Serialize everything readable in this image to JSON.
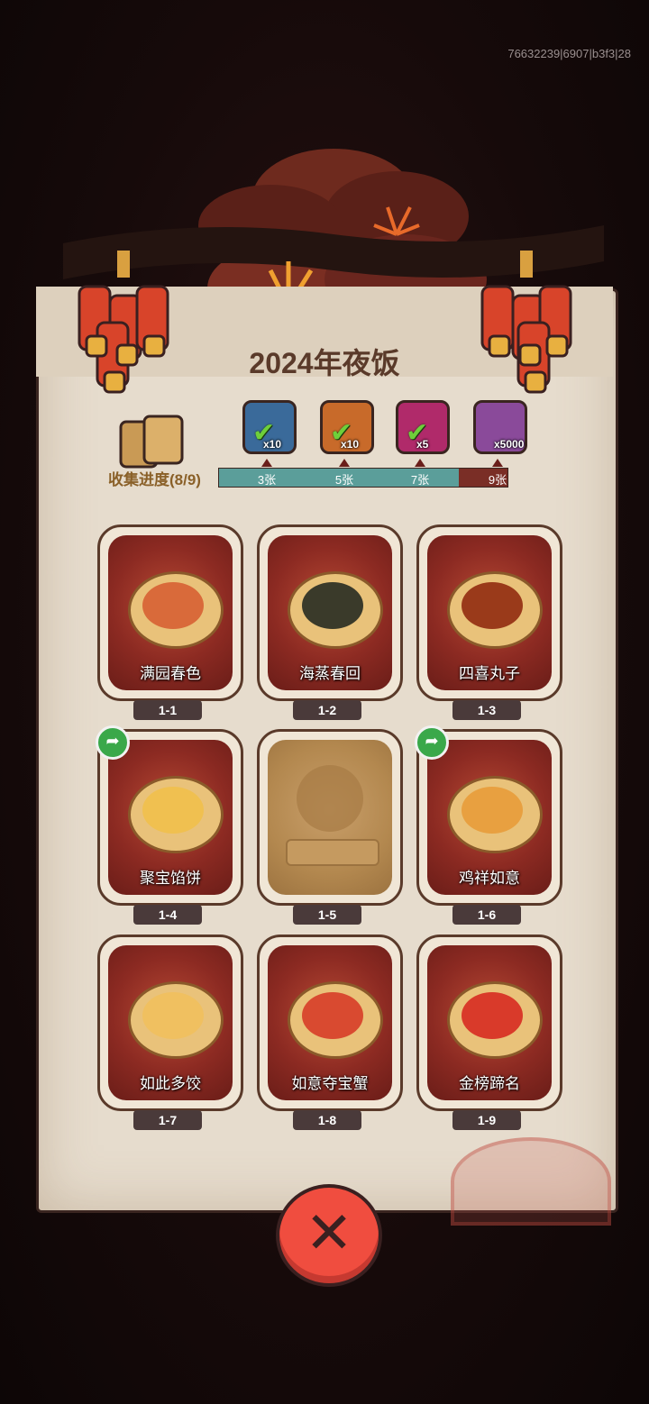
{
  "debug_id": "76632239|6907|b3f3|28",
  "title": "2024年夜饭",
  "collection": {
    "label": "收集进度(8/9)",
    "collected": 8,
    "total": 9,
    "fill_fraction": 0.83,
    "milestones": [
      {
        "label": "3张",
        "claimed": true,
        "reward_icon": "blue-tool-icon",
        "count": "x10"
      },
      {
        "label": "5张",
        "claimed": true,
        "reward_icon": "orange-key-icon",
        "count": "x10"
      },
      {
        "label": "7张",
        "claimed": true,
        "reward_icon": "purple-orb-icon",
        "count": "x5"
      },
      {
        "label": "9张",
        "claimed": false,
        "reward_icon": "crystal-icon",
        "count": "x5000"
      }
    ]
  },
  "cards": [
    {
      "name": "满园春色",
      "number": "1-1",
      "locked": false,
      "shareable": false,
      "food_color": "#d96a3a"
    },
    {
      "name": "海蒸春回",
      "number": "1-2",
      "locked": false,
      "shareable": false,
      "food_color": "#3a3a2a"
    },
    {
      "name": "四喜丸子",
      "number": "1-3",
      "locked": false,
      "shareable": false,
      "food_color": "#9a3a1a"
    },
    {
      "name": "聚宝馅饼",
      "number": "1-4",
      "locked": false,
      "shareable": true,
      "food_color": "#f0c050"
    },
    {
      "name": "",
      "number": "1-5",
      "locked": true,
      "shareable": false,
      "food_color": "#b3884f"
    },
    {
      "name": "鸡祥如意",
      "number": "1-6",
      "locked": false,
      "shareable": true,
      "food_color": "#e8a040"
    },
    {
      "name": "如此多饺",
      "number": "1-7",
      "locked": false,
      "shareable": false,
      "food_color": "#f0c060"
    },
    {
      "name": "如意夺宝蟹",
      "number": "1-8",
      "locked": false,
      "shareable": false,
      "food_color": "#d94a30"
    },
    {
      "name": "金榜蹄名",
      "number": "1-9",
      "locked": false,
      "shareable": false,
      "food_color": "#d93a2a"
    }
  ],
  "colors": {
    "paper": "#e6dccd",
    "progress_fill": "#5b9e9a",
    "progress_empty": "#7a2e26",
    "close_button": "#f04d3f"
  }
}
